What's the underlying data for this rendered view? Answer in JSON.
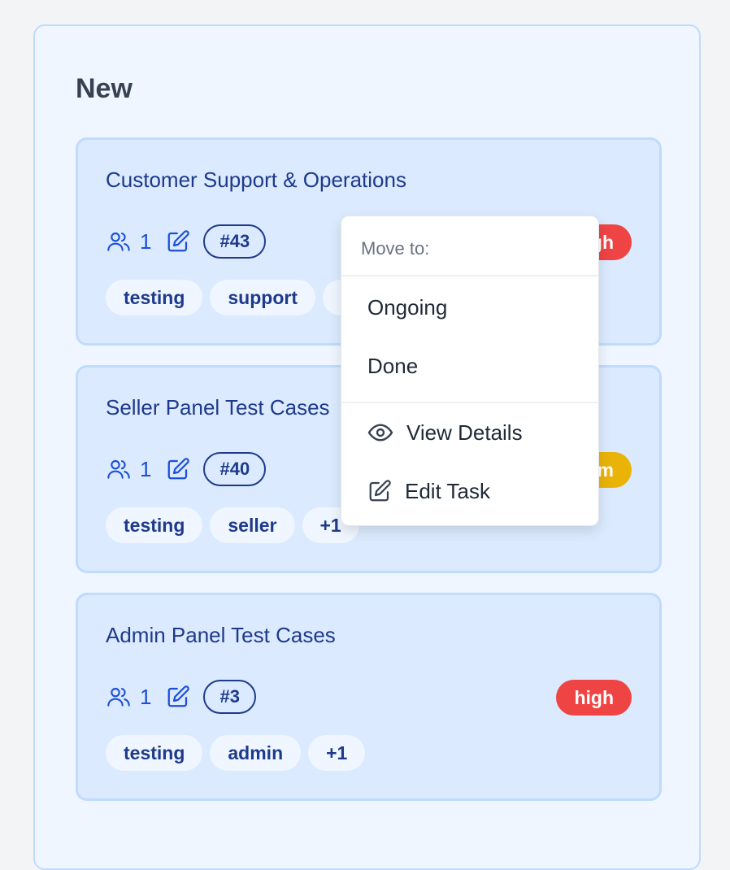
{
  "column": {
    "title": "New"
  },
  "cards": [
    {
      "title": "Customer Support & Operations",
      "assignees": "1",
      "id": "#43",
      "priority": "high",
      "priority_color": "#ef4444",
      "tags": [
        "testing",
        "support",
        "+1"
      ]
    },
    {
      "title": "Seller Panel Test Cases",
      "assignees": "1",
      "id": "#40",
      "priority": "medium",
      "priority_color": "#eab308",
      "tags": [
        "testing",
        "seller",
        "+1"
      ]
    },
    {
      "title": "Admin Panel Test Cases",
      "assignees": "1",
      "id": "#3",
      "priority": "high",
      "priority_color": "#ef4444",
      "tags": [
        "testing",
        "admin",
        "+1"
      ]
    }
  ],
  "context_menu": {
    "header": "Move to:",
    "move_options": [
      "Ongoing",
      "Done"
    ],
    "actions": [
      {
        "label": "View Details",
        "icon": "eye-icon"
      },
      {
        "label": "Edit Task",
        "icon": "edit-icon"
      }
    ]
  },
  "colors": {
    "column_bg": "#eff6ff",
    "card_bg": "#dbeafe",
    "accent": "#1d4ed8",
    "high": "#ef4444",
    "medium": "#eab308"
  }
}
